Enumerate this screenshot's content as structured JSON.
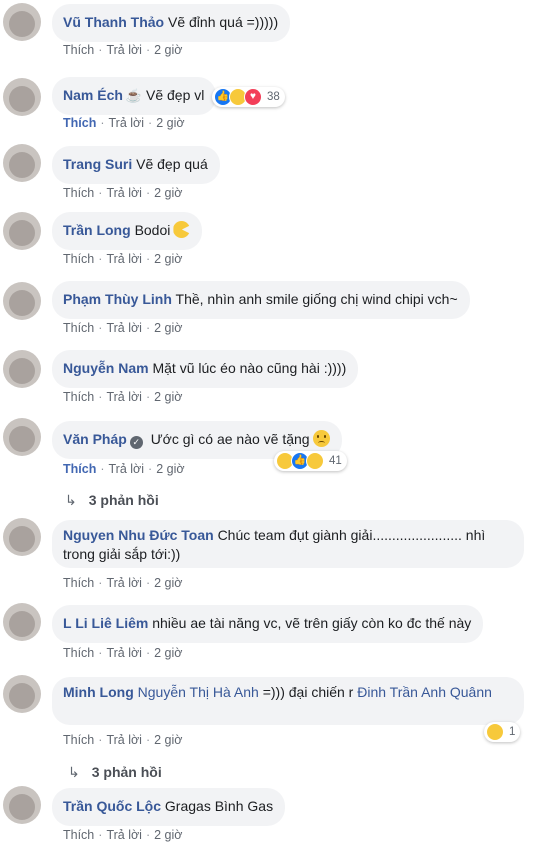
{
  "labels": {
    "like": "Thích",
    "reply": "Trả lời"
  },
  "comments": [
    {
      "name": "Vũ Thanh Thảo",
      "text": "Vẽ đỉnh quá =)))))",
      "time": "2 giờ"
    },
    {
      "name": "Nam Éch",
      "text": "Vẽ đẹp vl",
      "time": "2 giờ",
      "reactions": [
        "like",
        "haha",
        "love"
      ],
      "reaction_count": "38",
      "liked": true
    },
    {
      "name": "Trang Suri",
      "text": "Vẽ đẹp quá",
      "time": "2 giờ"
    },
    {
      "name": "Trần Long",
      "text": "Bodoi",
      "time": "2 giờ"
    },
    {
      "name": "Phạm Thùy Linh",
      "text": "Thề, nhìn anh smile giống chị wind chipi vch~",
      "time": "2 giờ"
    },
    {
      "name": "Nguyễn Nam",
      "text": "Mặt vũ lúc éo nào cũng hài :))))",
      "time": "2 giờ"
    },
    {
      "name": "Văn Pháp",
      "text": "Ước gì có ae nào vẽ tặng",
      "time": "2 giờ",
      "reactions": [
        "haha",
        "like",
        "sad"
      ],
      "reaction_count": "41",
      "liked": true,
      "replies": "3 phản hồi"
    },
    {
      "name": "Nguyen Nhu Đức Toan",
      "text": "Chúc team đụt giành giải....................... nhì trong giải sắp tới:))",
      "time": "2 giờ"
    },
    {
      "name": "L Li Liê Liêm",
      "text": "nhiều ae tài năng vc, vẽ trên giấy còn ko đc thế này",
      "time": "2 giờ"
    },
    {
      "name": "Minh Long",
      "tag1": "Nguyễn Thị Hà Anh",
      "text": "=))) đại chiến r",
      "tag2": "Đinh Trần Anh Quânn",
      "time": "2 giờ",
      "reactions": [
        "haha"
      ],
      "reaction_count": "1",
      "replies": "3 phản hồi"
    },
    {
      "name": "Trần Quốc Lộc",
      "text": "Gragas Bình Gas",
      "time": "2 giờ"
    }
  ],
  "colors": {
    "name": "#385898",
    "bubble": "#f2f3f5",
    "meta": "#616770",
    "like_active": "#4267b2"
  }
}
